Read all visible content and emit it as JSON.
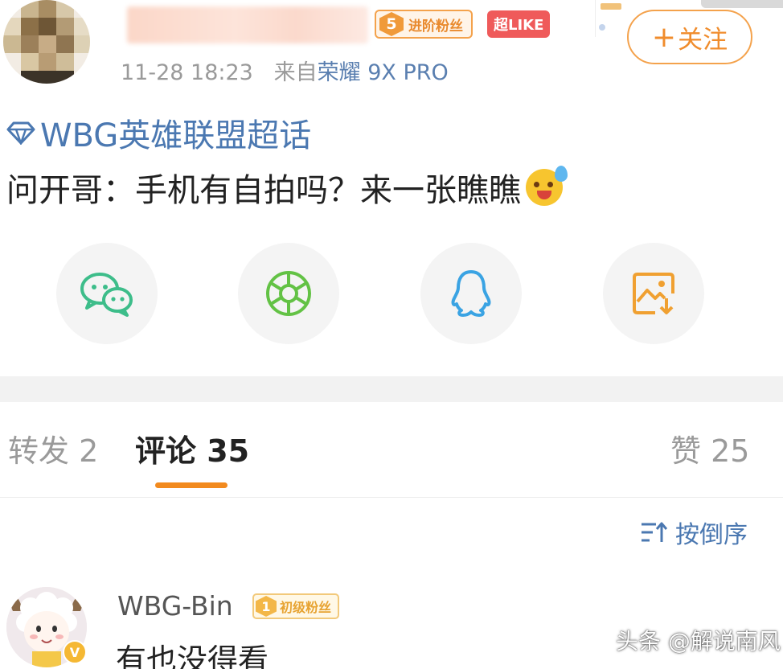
{
  "header": {
    "fan_badge": {
      "level": "5",
      "label": "进阶粉丝"
    },
    "like_badge": "超LIKE",
    "timestamp": "11-28 18:23",
    "source_prefix": "来自",
    "device": "荣耀 9X PRO",
    "follow_label": "关注",
    "follow_plus": "+"
  },
  "post": {
    "topic": "WBG英雄联盟超话",
    "text": "问开哥：手机有自拍吗？来一张瞧瞧",
    "emoji_icon": "laughing-tears-emoji"
  },
  "share": [
    {
      "icon": "wechat-icon",
      "color": "#3dbd8a"
    },
    {
      "icon": "moments-icon",
      "color": "#63c245"
    },
    {
      "icon": "qq-icon",
      "color": "#3aa3e3"
    },
    {
      "icon": "save-image-icon",
      "color": "#f0a031"
    }
  ],
  "tabs": {
    "repost": "转发 2",
    "comment": "评论 35",
    "like": "赞 25"
  },
  "sort_label": "按倒序",
  "comment": {
    "username": "WBG-Bin",
    "fan_badge": {
      "level": "1",
      "label": "初级粉丝"
    },
    "verified": "V",
    "text": "有也没得看"
  },
  "watermark": "头条 @解说南风",
  "colors": {
    "accent_orange": "#f28a1e",
    "link_blue": "#4b78b1",
    "like_red": "#ef5a5a"
  }
}
